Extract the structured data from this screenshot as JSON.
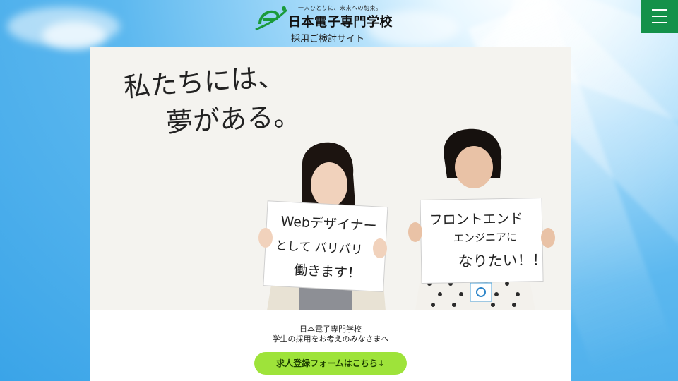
{
  "header": {
    "tagline": "一人ひとりに、未来への約束。",
    "school_name": "日本電子専門学校",
    "site_subtitle": "採用ご検討サイト"
  },
  "hero": {
    "headline_line1": "私たちには、",
    "headline_line2": "夢がある。",
    "sign_left": [
      "Webデザイナー",
      "として バリバリ",
      "働きます！"
    ],
    "sign_right": [
      "フロントエンド",
      "エンジニアに",
      "なりたい！！"
    ]
  },
  "intro": {
    "line1": "日本電子専門学校",
    "line2": "学生の採用をお考えのみなさまへ"
  },
  "cta": {
    "label": "求人登録フォームはこちら↓"
  },
  "colors": {
    "menu": "#14914a",
    "cta": "#9ee33a",
    "sky": "#3aa4e8"
  }
}
